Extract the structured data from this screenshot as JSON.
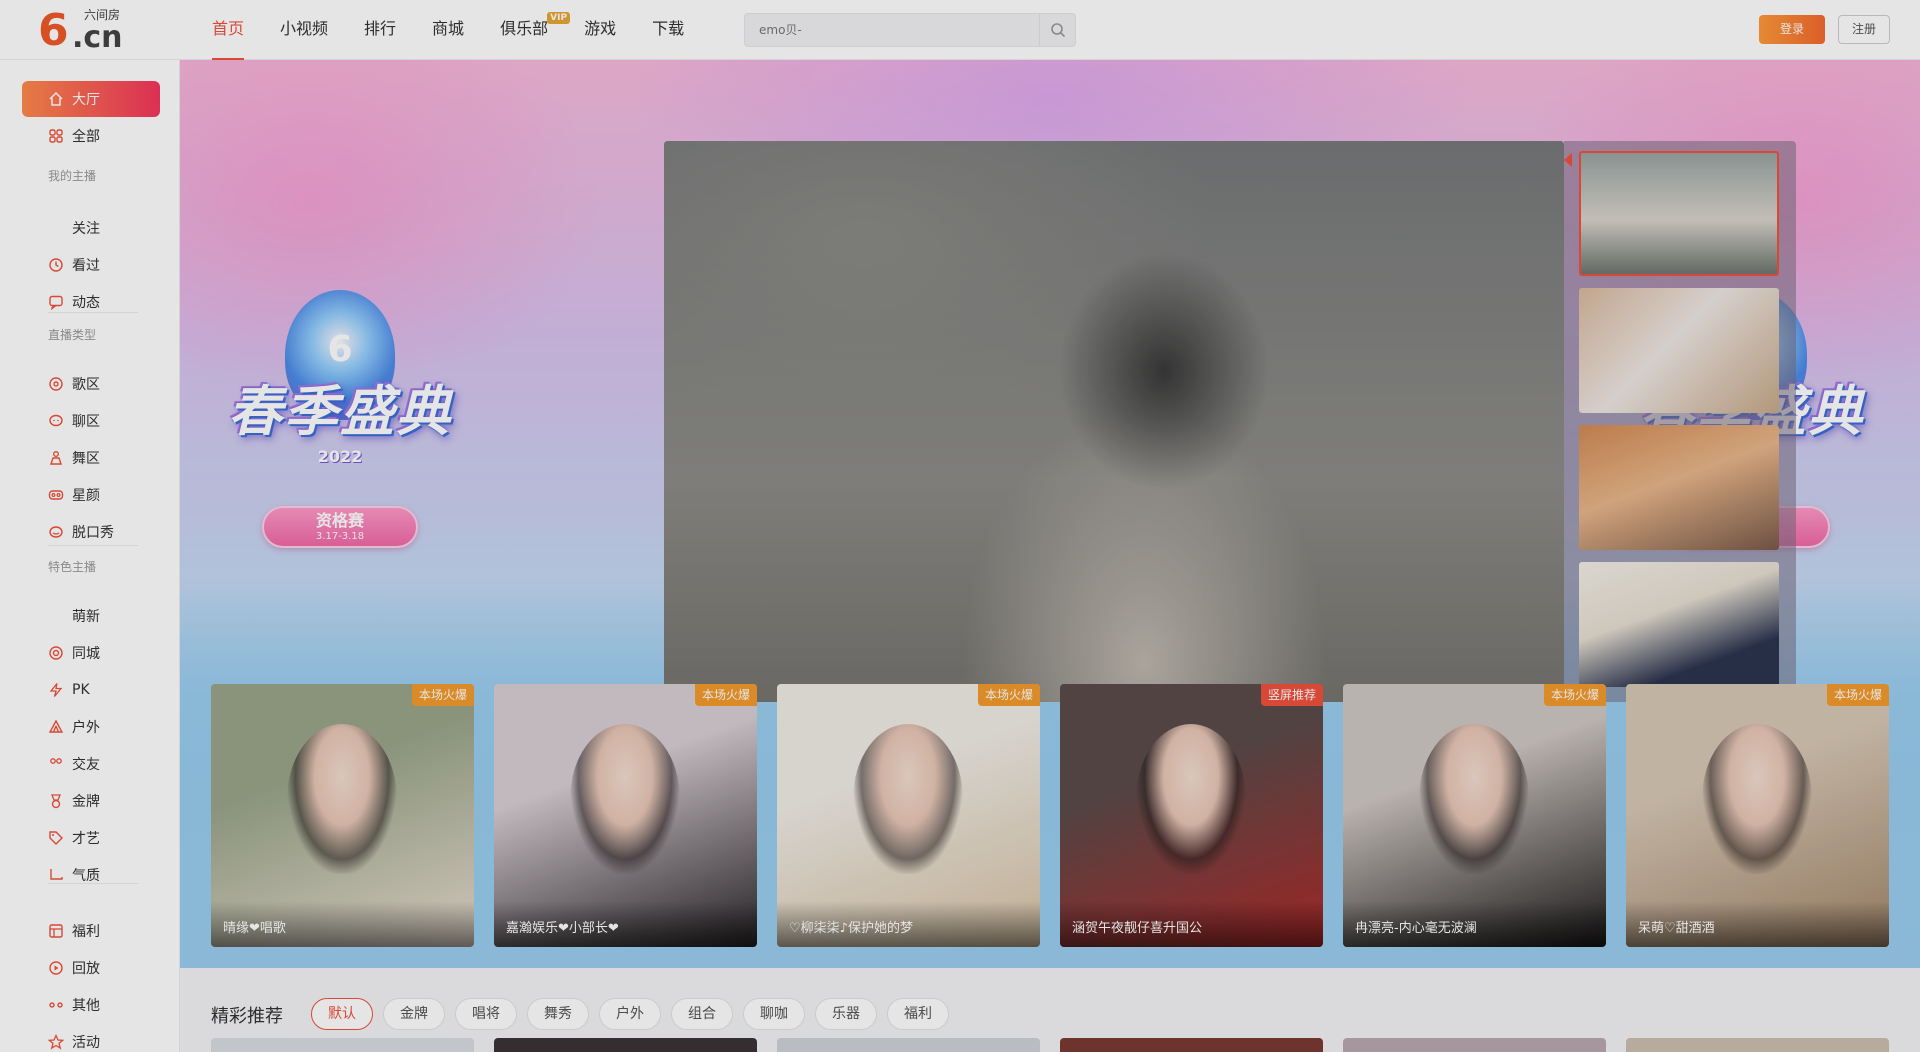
{
  "logo": {
    "mark": "6",
    "text": ".cn",
    "name": "六间房"
  },
  "nav": [
    {
      "label": "首页",
      "active": true
    },
    {
      "label": "小视频"
    },
    {
      "label": "排行"
    },
    {
      "label": "商城"
    },
    {
      "label": "俱乐部",
      "badge": "VIP"
    },
    {
      "label": "游戏"
    },
    {
      "label": "下载"
    }
  ],
  "search": {
    "placeholder": "emo贝-"
  },
  "auth": {
    "login": "登录",
    "register": "注册"
  },
  "sidebar": {
    "items": [
      {
        "label": "大厅",
        "icon": "home-icon",
        "active": true
      },
      {
        "label": "全部",
        "icon": "grid-icon"
      },
      {
        "label": "关注",
        "icon": "heart-icon"
      },
      {
        "label": "看过",
        "icon": "clock-icon"
      },
      {
        "label": "动态",
        "icon": "chat-icon"
      },
      {
        "label": "歌区",
        "icon": "music-icon"
      },
      {
        "label": "聊区",
        "icon": "bubble-icon"
      },
      {
        "label": "舞区",
        "icon": "dance-icon"
      },
      {
        "label": "星颜",
        "icon": "mask-icon"
      },
      {
        "label": "脱口秀",
        "icon": "mic-icon"
      },
      {
        "label": "萌新",
        "icon": "sprout-icon"
      },
      {
        "label": "同城",
        "icon": "location-icon"
      },
      {
        "label": "PK",
        "icon": "lightning-icon"
      },
      {
        "label": "户外",
        "icon": "tent-icon"
      },
      {
        "label": "交友",
        "icon": "people-icon"
      },
      {
        "label": "金牌",
        "icon": "medal-icon"
      },
      {
        "label": "才艺",
        "icon": "tag-icon"
      },
      {
        "label": "气质",
        "icon": "shoe-icon"
      },
      {
        "label": "福利",
        "icon": "gift-icon"
      },
      {
        "label": "回放",
        "icon": "replay-icon"
      },
      {
        "label": "其他",
        "icon": "dots-icon"
      },
      {
        "label": "活动",
        "icon": "star-icon"
      }
    ],
    "sections": [
      "我的主播",
      "直播类型",
      "特色主播"
    ]
  },
  "festival": {
    "title": "春季盛典",
    "year": "2022",
    "stage": "资格赛",
    "dates": "3.17-3.18"
  },
  "cards": [
    {
      "name": "晴缘❤唱歌",
      "tag": "本场火爆",
      "tag_color": "#f39a2b",
      "colors": [
        "#9aa58a",
        "#e8ddd0"
      ]
    },
    {
      "name": "嘉瀚娱乐❤小部长❤",
      "tag": "本场火爆",
      "tag_color": "#f39a2b",
      "colors": [
        "#d8cfd4",
        "#2a2629"
      ]
    },
    {
      "name": "♡柳柒柒♪保护她的梦",
      "tag": "本场火爆",
      "tag_color": "#f39a2b",
      "colors": [
        "#f0ece6",
        "#d6c2a4"
      ]
    },
    {
      "name": "涵贺午夜靓仔喜升国公",
      "tag": "竖屏推荐",
      "tag_color": "#f0523d",
      "colors": [
        "#5a4b4a",
        "#b02a2a"
      ]
    },
    {
      "name": "冉漂亮-内心毫无波澜",
      "tag": "本场火爆",
      "tag_color": "#f39a2b",
      "colors": [
        "#cfc8c3",
        "#1e1c1c"
      ]
    },
    {
      "name": "呆萌♡甜酒酒",
      "tag": "本场火爆",
      "tag_color": "#f39a2b",
      "colors": [
        "#d7c8b5",
        "#a3876b"
      ]
    }
  ],
  "recommend": {
    "title": "精彩推荐",
    "tabs": [
      "默认",
      "金牌",
      "唱将",
      "舞秀",
      "户外",
      "组合",
      "聊咖",
      "乐器",
      "福利"
    ]
  }
}
